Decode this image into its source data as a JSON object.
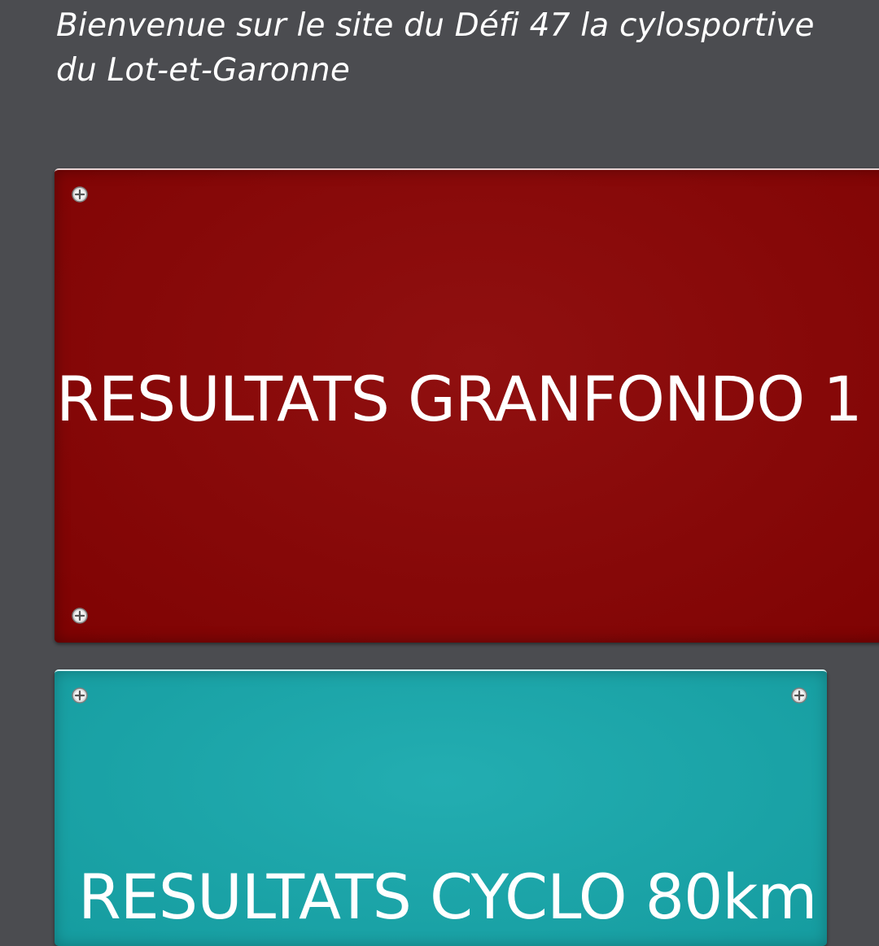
{
  "header": {
    "welcome_text": "Bienvenue sur le site du Défi 47 la cylosportive du Lot-et-Garonne"
  },
  "panels": [
    {
      "label": "RESULTATS GRANFONDO 1",
      "color": "#8a0303"
    },
    {
      "label": "RESULTATS CYCLO 80km",
      "color": "#17a9ad"
    }
  ],
  "icons": {
    "screw": "screw-icon"
  }
}
